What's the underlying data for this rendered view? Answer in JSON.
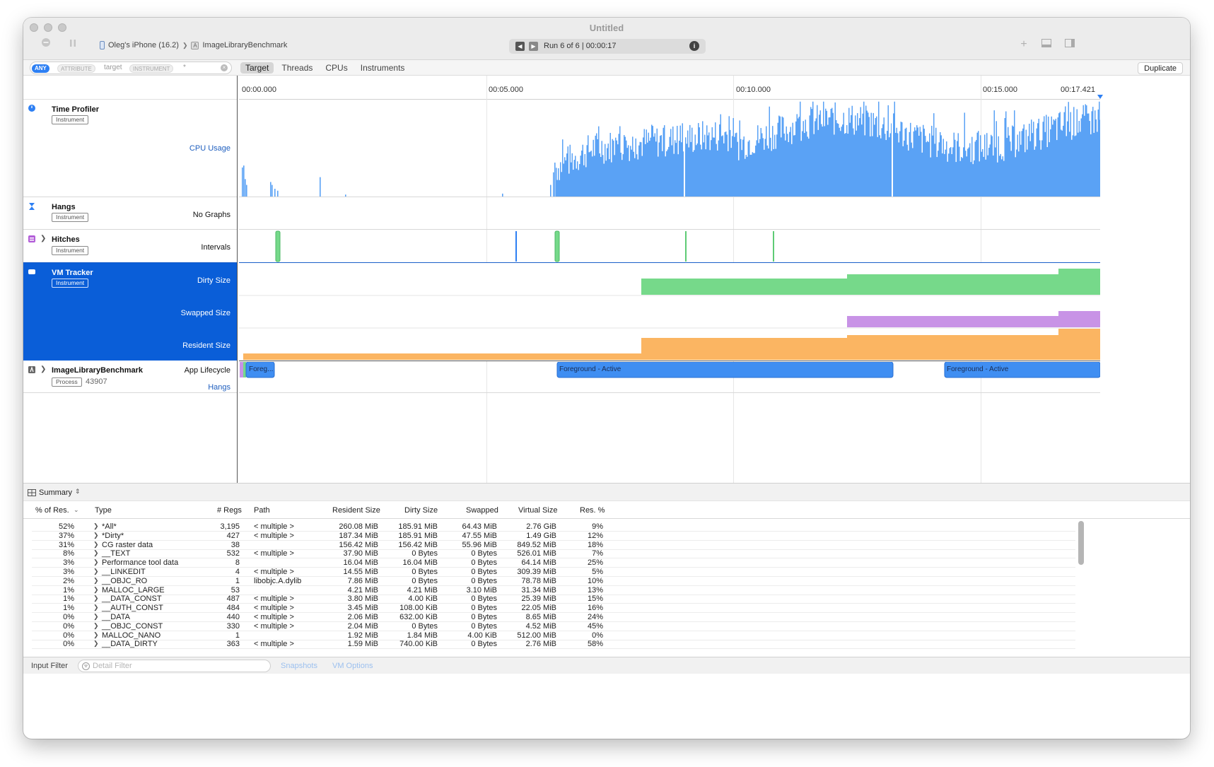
{
  "window": {
    "title": "Untitled"
  },
  "toolbar": {
    "device": "Oleg's iPhone (16.2)",
    "separator": "❯",
    "target": "ImageLibraryBenchmark",
    "run": "Run 6 of 6  |  00:00:17",
    "add_icon": "+",
    "duplicate": "Duplicate"
  },
  "filter": {
    "any": "ANY",
    "attribute": "ATTRIBUTE",
    "target_value": "target",
    "instrument": "INSTRUMENT",
    "star": "*"
  },
  "tabs": [
    "Target",
    "Threads",
    "CPUs",
    "Instruments"
  ],
  "timeline": {
    "ticks": [
      "00:00.000",
      "00:05.000",
      "00:10.000",
      "00:15.000",
      "00:17.421"
    ]
  },
  "tracks": {
    "time_profiler": {
      "name": "Time Profiler",
      "badge": "Instrument",
      "label": "CPU Usage"
    },
    "hangs": {
      "name": "Hangs",
      "badge": "Instrument",
      "label": "No Graphs"
    },
    "hitches": {
      "name": "Hitches",
      "badge": "Instrument",
      "label": "Intervals"
    },
    "vm_tracker": {
      "name": "VM Tracker",
      "badge": "Instrument",
      "labels": [
        "Dirty Size",
        "Swapped Size",
        "Resident Size"
      ]
    },
    "app": {
      "name": "ImageLibraryBenchmark",
      "badge": "Process",
      "pid": "43907",
      "label1": "App Lifecycle",
      "label2": "Hangs",
      "segments": [
        "Foreg...",
        "Foreground - Active",
        "Foreground - Active"
      ]
    }
  },
  "summary": {
    "title": "Summary",
    "columns": [
      "% of Res.",
      "Type",
      "# Regs",
      "Path",
      "Resident Size",
      "Dirty Size",
      "Swapped",
      "Virtual Size",
      "Res. %"
    ],
    "rows": [
      [
        "52%",
        "*All*",
        "3,195",
        "< multiple >",
        "260.08 MiB",
        "185.91 MiB",
        "64.43 MiB",
        "2.76 GiB",
        "9%"
      ],
      [
        "37%",
        "*Dirty*",
        "427",
        "< multiple >",
        "187.34 MiB",
        "185.91 MiB",
        "47.55 MiB",
        "1.49 GiB",
        "12%"
      ],
      [
        "31%",
        "CG raster data",
        "38",
        "",
        "156.42 MiB",
        "156.42 MiB",
        "55.96 MiB",
        "849.52 MiB",
        "18%"
      ],
      [
        "8%",
        "__TEXT",
        "532",
        "< multiple >",
        "37.90 MiB",
        "0 Bytes",
        "0 Bytes",
        "526.01 MiB",
        "7%"
      ],
      [
        "3%",
        "Performance tool data",
        "8",
        "",
        "16.04 MiB",
        "16.04 MiB",
        "0 Bytes",
        "64.14 MiB",
        "25%"
      ],
      [
        "3%",
        "__LINKEDIT",
        "4",
        "< multiple >",
        "14.55 MiB",
        "0 Bytes",
        "0 Bytes",
        "309.39 MiB",
        "5%"
      ],
      [
        "2%",
        "__OBJC_RO",
        "1",
        "libobjc.A.dylib",
        "7.86 MiB",
        "0 Bytes",
        "0 Bytes",
        "78.78 MiB",
        "10%"
      ],
      [
        "1%",
        "MALLOC_LARGE",
        "53",
        "",
        "4.21 MiB",
        "4.21 MiB",
        "3.10 MiB",
        "31.34 MiB",
        "13%"
      ],
      [
        "1%",
        "__DATA_CONST",
        "487",
        "< multiple >",
        "3.80 MiB",
        "4.00 KiB",
        "0 Bytes",
        "25.39 MiB",
        "15%"
      ],
      [
        "1%",
        "__AUTH_CONST",
        "484",
        "< multiple >",
        "3.45 MiB",
        "108.00 KiB",
        "0 Bytes",
        "22.05 MiB",
        "16%"
      ],
      [
        "0%",
        "__DATA",
        "440",
        "< multiple >",
        "2.06 MiB",
        "632.00 KiB",
        "0 Bytes",
        "8.65 MiB",
        "24%"
      ],
      [
        "0%",
        "__OBJC_CONST",
        "330",
        "< multiple >",
        "2.04 MiB",
        "0 Bytes",
        "0 Bytes",
        "4.52 MiB",
        "45%"
      ],
      [
        "0%",
        "MALLOC_NANO",
        "1",
        "",
        "1.92 MiB",
        "1.84 MiB",
        "4.00 KiB",
        "512.00 MiB",
        "0%"
      ],
      [
        "0%",
        "__DATA_DIRTY",
        "363",
        "< multiple >",
        "1.59 MiB",
        "740.00 KiB",
        "0 Bytes",
        "2.76 MiB",
        "58%"
      ]
    ]
  },
  "bottom": {
    "input_filter": "Input Filter",
    "detail_placeholder": "Detail Filter",
    "snapshots": "Snapshots",
    "vm_options": "VM Options"
  },
  "colors": {
    "cpu": "#5aa2f5",
    "dirty": "#76d98a",
    "swapped": "#c893e6",
    "resident": "#fbb562",
    "selection": "#0a5ed8",
    "segment": "#3f8ef2"
  }
}
